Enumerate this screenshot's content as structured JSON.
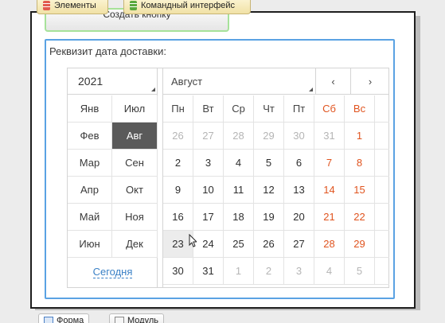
{
  "top_tabs": [
    {
      "label": "Элементы",
      "icon": "red-stack-icon"
    },
    {
      "label": "Командный интерфейс",
      "icon": "green-stack-icon"
    }
  ],
  "create_button_label": "Создать кнопку",
  "field": {
    "label": "Реквизит дата доставки:"
  },
  "calendar": {
    "year": "2021",
    "month": "Август",
    "nav_prev": "‹",
    "nav_next": "›",
    "months": [
      [
        "Янв",
        "Июл"
      ],
      [
        "Фев",
        "Авг"
      ],
      [
        "Мар",
        "Сен"
      ],
      [
        "Апр",
        "Окт"
      ],
      [
        "Май",
        "Ноя"
      ],
      [
        "Июн",
        "Дек"
      ]
    ],
    "selected_month": "Авг",
    "today_label": "Сегодня",
    "weekdays": [
      "Пн",
      "Вт",
      "Ср",
      "Чт",
      "Пт",
      "Сб",
      "Вс"
    ],
    "weeks": [
      [
        "26",
        "27",
        "28",
        "29",
        "30",
        "31",
        "1"
      ],
      [
        "2",
        "3",
        "4",
        "5",
        "6",
        "7",
        "8"
      ],
      [
        "9",
        "10",
        "11",
        "12",
        "13",
        "14",
        "15"
      ],
      [
        "16",
        "17",
        "18",
        "19",
        "20",
        "21",
        "22"
      ],
      [
        "23",
        "24",
        "25",
        "26",
        "27",
        "28",
        "29"
      ],
      [
        "30",
        "31",
        "1",
        "2",
        "3",
        "4",
        "5"
      ]
    ],
    "hover_day": "23",
    "weekend_color": "#e0541f",
    "selected_month_color": "#5a5a5a"
  },
  "bottom_tabs": [
    {
      "label": "Форма",
      "icon": "form-icon"
    },
    {
      "label": "Модуль",
      "icon": "module-icon"
    }
  ]
}
